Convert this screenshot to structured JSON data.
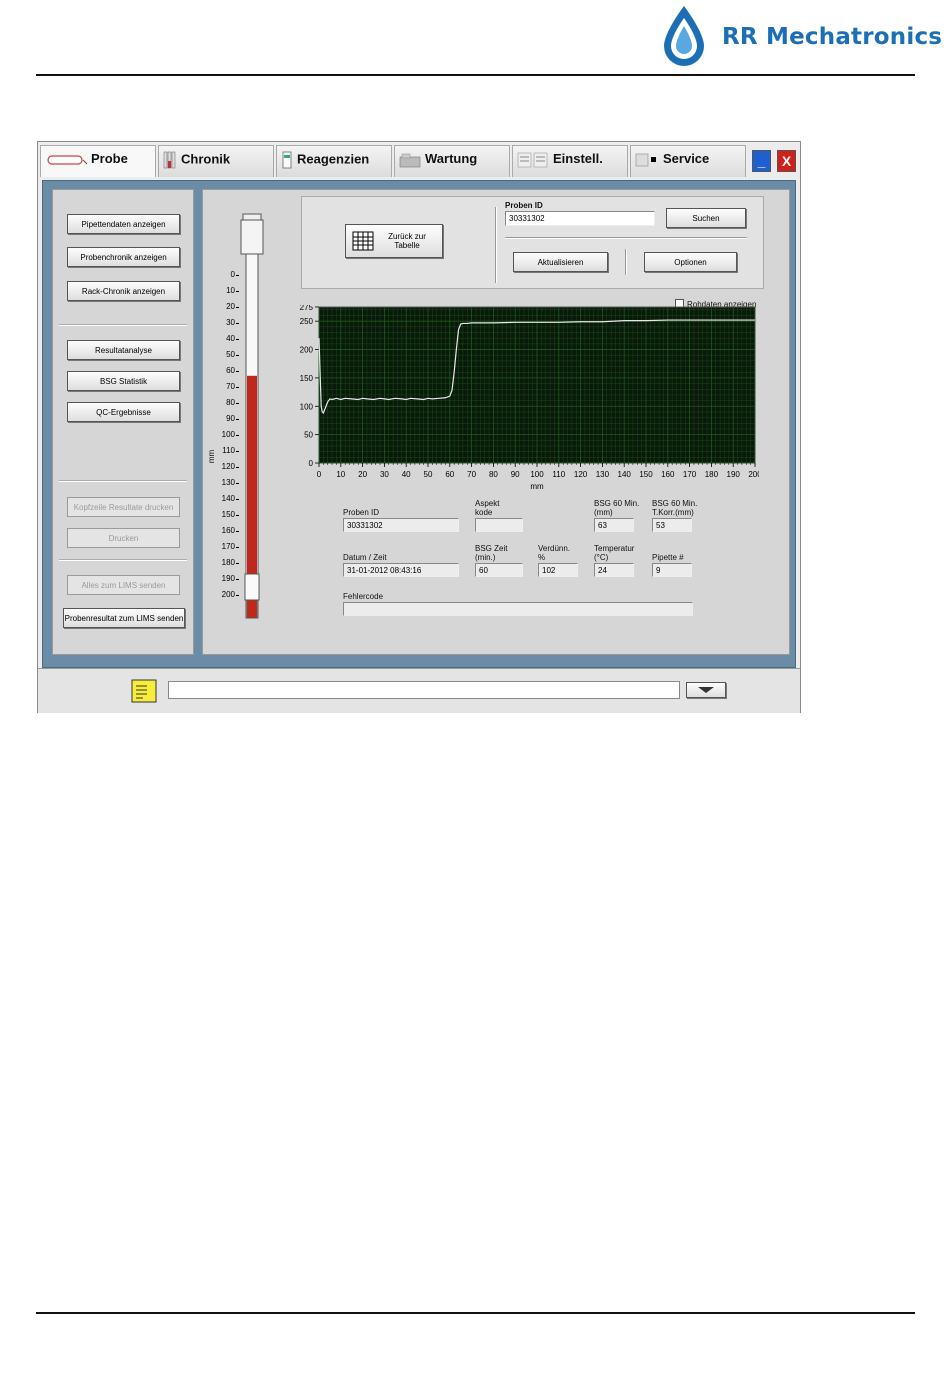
{
  "brand": {
    "name": "RR Mechatronics"
  },
  "window": {
    "tabs": [
      {
        "label": "Probe",
        "icon": "sample-icon"
      },
      {
        "label": "Chronik",
        "icon": "history-icon"
      },
      {
        "label": "Reagenzien",
        "icon": "reagent-icon"
      },
      {
        "label": "Wartung",
        "icon": "maintenance-icon"
      },
      {
        "label": "Einstell.",
        "icon": "settings-icon"
      },
      {
        "label": "Service",
        "icon": "service-icon"
      }
    ],
    "minimize_label": "_",
    "close_label": "X"
  },
  "sidebar": {
    "buttons": [
      {
        "label": "Pipettendaten anzeigen",
        "enabled": true
      },
      {
        "label": "Probenchronik anzeigen",
        "enabled": true
      },
      {
        "label": "Rack-Chronik anzeigen",
        "enabled": true
      },
      {
        "label": "Resultatanalyse",
        "enabled": true
      },
      {
        "label": "BSG Statistik",
        "enabled": true
      },
      {
        "label": "QC-Ergebnisse",
        "enabled": true
      },
      {
        "label": "Kopfzeile Resultate drucken",
        "enabled": false
      },
      {
        "label": "Drucken",
        "enabled": false
      },
      {
        "label": "Alles zum LIMS senden",
        "enabled": false
      },
      {
        "label": "Probenresultat zum LIMS senden",
        "enabled": true
      }
    ]
  },
  "tube_scale": {
    "unit": "mm",
    "ticks": [
      "0",
      "10",
      "20",
      "30",
      "40",
      "50",
      "60",
      "70",
      "80",
      "90",
      "100",
      "110",
      "120",
      "130",
      "140",
      "150",
      "160",
      "170",
      "180",
      "190",
      "200"
    ],
    "blood_level_mm": 63
  },
  "top_panel": {
    "back_button": "Zurück zur Tabelle",
    "proben_id_label": "Proben ID",
    "proben_id_value": "30331302",
    "search_button": "Suchen",
    "refresh_button": "Aktualisieren",
    "options_button": "Optionen"
  },
  "raw_data_checkbox": {
    "label": "Rohdaten anzeigen",
    "checked": false
  },
  "chart_data": {
    "type": "line",
    "xlabel": "mm",
    "ylabel": "",
    "xlim": [
      0,
      200
    ],
    "ylim": [
      0,
      275
    ],
    "xticks": [
      0,
      10,
      20,
      30,
      40,
      50,
      60,
      70,
      80,
      90,
      100,
      110,
      120,
      130,
      140,
      150,
      160,
      170,
      180,
      190,
      200
    ],
    "yticks": [
      0,
      50,
      100,
      150,
      200,
      250,
      275
    ],
    "grid": true,
    "background": "#0a1a0a",
    "grid_color": "#1f5a1f",
    "line_color": "#e8e8e8",
    "series": [
      {
        "x": [
          0,
          0.5,
          1,
          1.5,
          2,
          3,
          4,
          5,
          6,
          8,
          10,
          12,
          15,
          18,
          20,
          22,
          25,
          28,
          30,
          32,
          35,
          38,
          40,
          42,
          45,
          48,
          50,
          52,
          55,
          58,
          60,
          61,
          62,
          63,
          64,
          65,
          66,
          68,
          70,
          75,
          80,
          90,
          100,
          110,
          120,
          130,
          140,
          150,
          160,
          170,
          180,
          190,
          200
        ],
        "y": [
          220,
          160,
          100,
          90,
          88,
          98,
          108,
          113,
          112,
          114,
          112,
          114,
          113,
          112,
          114,
          113,
          112,
          114,
          113,
          112,
          114,
          113,
          112,
          114,
          113,
          112,
          114,
          113,
          114,
          115,
          118,
          128,
          160,
          200,
          235,
          245,
          246,
          246,
          247,
          247,
          247,
          248,
          248,
          248,
          249,
          249,
          251,
          251,
          252,
          252,
          252,
          252,
          252
        ]
      }
    ]
  },
  "results": {
    "proben_id_label": "Proben ID",
    "proben_id_value": "30331302",
    "aspekt_label": "Aspekt kode",
    "aspekt_value": "",
    "bsg60_label": "BSG 60 Min. (mm)",
    "bsg60_value": "63",
    "bsg60korr_label": "BSG 60 Min. T.Korr.(mm)",
    "bsg60korr_value": "53",
    "datum_label": "Datum / Zeit",
    "datum_value": "31-01-2012 08:43:16",
    "bsgzeit_label": "BSG Zeit (min.)",
    "bsgzeit_value": "60",
    "verduenn_label": "Verdünn. %",
    "verduenn_value": "102",
    "temperatur_label": "Temperatur (°C)",
    "temperatur_value": "24",
    "pipette_label": "Pipette #",
    "pipette_value": "9",
    "fehlercode_label": "Fehlercode",
    "fehlercode_value": ""
  },
  "status_bar": {
    "message": "",
    "icon": "notes-icon",
    "dropdown_icon": "arrow-down-icon"
  }
}
